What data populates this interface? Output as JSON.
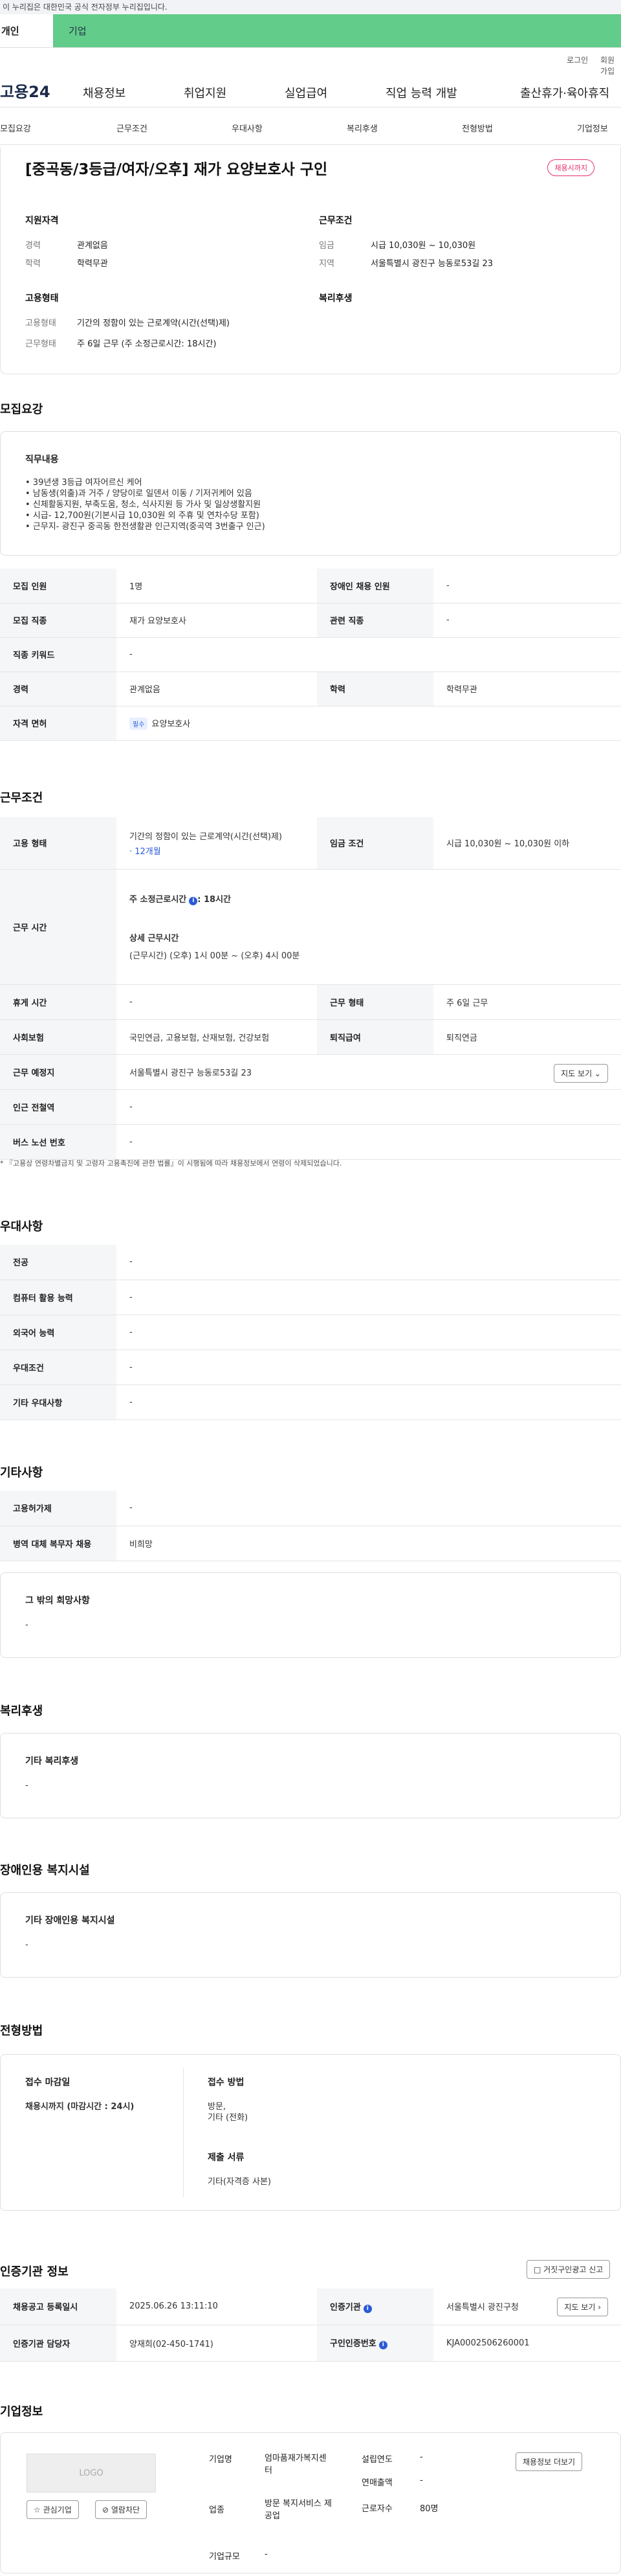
{
  "top_notice": "이 누리집은 대한민국 공식 전자정부 누리집입니다.",
  "tabs": {
    "person": "개인",
    "corp": "기업"
  },
  "util": {
    "login": "로그인",
    "join": "회원가입"
  },
  "gnb": {
    "logo": "고용24",
    "items": [
      "채용정보",
      "취업지원",
      "실업급여",
      "직업 능력 개발",
      "출산휴가·육아휴직"
    ]
  },
  "subnav": [
    "모집요강",
    "근무조건",
    "우대사항",
    "복리후생",
    "전형방법",
    "기업정보"
  ],
  "summary": {
    "title": "[중곡동/3등급/여자/오후] 재가 요양보호사 구인",
    "badge": "채용시까지",
    "qual_h": "지원자격",
    "exp_k": "경력",
    "exp_v": "관계없음",
    "edu_k": "학력",
    "edu_v": "학력무관",
    "cond_h": "근무조건",
    "wage_k": "임금",
    "wage_v": "시급 10,030원 ~ 10,030원",
    "loc_k": "지역",
    "loc_v": "서울특별시 광진구 능동로53길 23",
    "emp_h": "고용형태",
    "emp_k": "고용형태",
    "emp_v": "기간의 정함이 있는 근로계약(시간(선택)제)",
    "work_k": "근무형태",
    "work_v": "주 6일 근무 (주 소정근로시간: 18시간)",
    "welfare_h": "복리후생"
  },
  "recruit": {
    "title": "모집요강",
    "job_h": "직무내용",
    "job_body": "• 39년생 3등급 여자어르신 케어\n• 남동생(외출)과 거주 / 양당이로 일덴서 이동 / 기저귀케어 있음\n• 신체활동지원, 부축도움, 청소, 식사지원 등 가사 및 일상생활지원\n• 시급- 12,700원(기본시급 10,030원 외 주휴 및 연차수당 포함)\n• 근무지- 광진구 중곡동 한전생활관 인근지역(중곡역 3번출구 인근)",
    "rows": [
      {
        "k": "모집 인원",
        "v": "1명",
        "k2": "장애인 채용 인원",
        "v2": "-"
      },
      {
        "k": "모집 직종",
        "v": "재가 요양보호사",
        "k2": "관련 직종",
        "v2": "-"
      },
      {
        "k": "직종 키워드",
        "v": "-"
      },
      {
        "k": "경력",
        "v": "관계없음",
        "k2": "학력",
        "v2": "학력무관"
      },
      {
        "k": "자격 면허",
        "pill": "필수",
        "v": "요양보호사"
      }
    ]
  },
  "work": {
    "title": "근무조건",
    "emp_k": "고용 형태",
    "emp_v": "기간의 정함이 있는 근로계약(시간(선택)제)",
    "emp_sub": "· 12개월",
    "wage_k": "임금 조건",
    "wage_v": "시급 10,030원 ~ 10,030원 이하",
    "time_k": "근무 시간",
    "time_a": "주 소정근로시간",
    "time_a2": ": 18시간",
    "time_b": "상세 근무시간",
    "time_c": "(근무시간) (오후) 1시 00분 ~ (오후) 4시 00분",
    "rest_k": "휴게 시간",
    "rest_v": "-",
    "form_k": "근무 형태",
    "form_v": "주 6일 근무",
    "ins_k": "사회보험",
    "ins_v": "국민연금, 고용보험, 산재보험, 건강보험",
    "ret_k": "퇴직급여",
    "ret_v": "퇴직연금",
    "place_k": "근무 예정지",
    "place_v": "서울특별시 광진구 능동로53길 23",
    "map_btn": "지도 보기 ⌄",
    "sub_k": "인근 전철역",
    "sub_v": "-",
    "bus_k": "버스 노선 번호",
    "bus_v": "-",
    "note": "* 『고용상 연령차별금지 및 고령자 고용촉진에 관한 법률』이 시행됨에 따라 채용정보에서 연령이 삭제되었습니다."
  },
  "pref": {
    "title": "우대사항",
    "rows": [
      {
        "k": "전공",
        "v": "-"
      },
      {
        "k": "컴퓨터 활용 능력",
        "v": "-"
      },
      {
        "k": "외국어 능력",
        "v": "-"
      },
      {
        "k": "우대조건",
        "v": "-"
      },
      {
        "k": "기타 우대사항",
        "v": "-"
      }
    ]
  },
  "etc": {
    "title": "기타사항",
    "rows": [
      {
        "k": "고용허가제",
        "v": "-"
      },
      {
        "k": "병역 대체 복무자 채용",
        "v": "비희망"
      }
    ],
    "box_h": "그 밖의 희망사항",
    "box_v": "-"
  },
  "welfare": {
    "title": "복리후생",
    "box_h": "기타 복리후생",
    "box_v": "-"
  },
  "disab": {
    "title": "장애인용 복지시설",
    "box_h": "기타 장애인용 복지시설",
    "box_v": "-"
  },
  "screen": {
    "title": "전형방법",
    "due_h": "접수 마감일",
    "due_v": "채용시까지 (마감시간 : 24시)",
    "method_h": "접수 방법",
    "method_v": "방문,\n기타 (전화)",
    "doc_h": "제출 서류",
    "doc_v": "기타(자격증 사본)"
  },
  "cert": {
    "title": "인증기관 정보",
    "report_btn": "□ 거짓구인광고 신고",
    "r1k": "채용공고 등록일시",
    "r1v": "2025.06.26 13:11:10",
    "r1k2": "인증기관",
    "r1v2": "서울특별시 광진구청",
    "map_btn": "지도 보기 ›",
    "r2k": "인증기관 담당자",
    "r2v": "양재희(02-450-1741)",
    "r2k2": "구인인증번호",
    "r2v2": "KJA0002506260001"
  },
  "company": {
    "title": "기업정보",
    "logo": "LOGO",
    "fav": "☆ 관심기업",
    "block": "⊘ 열람차단",
    "name_k": "기업명",
    "name_v": "엄마품재가복지센터",
    "year_k": "설립연도",
    "year_v": "-",
    "ind_k": "업종",
    "ind_v": "방문 복지서비스 제공업",
    "sales_k": "연매출액",
    "sales_v": "-",
    "emp_k": "근로자수",
    "emp_v": "80명",
    "size_k": "기업규모",
    "size_v": "-",
    "more": "채용정보 더보기"
  }
}
